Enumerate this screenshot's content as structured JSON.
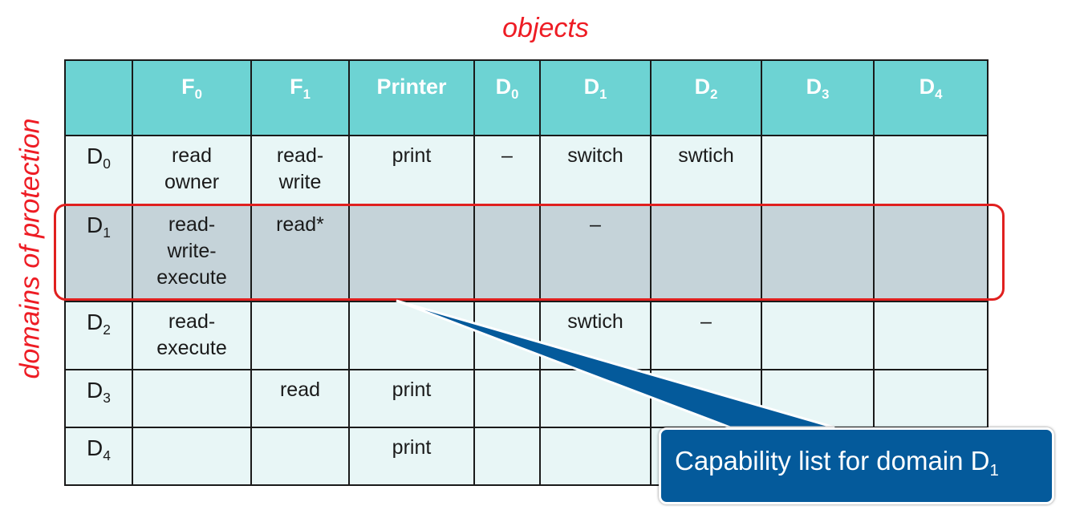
{
  "labels": {
    "objects": "objects",
    "domains": "domains of protection"
  },
  "columns": [
    {
      "base": "",
      "sub": ""
    },
    {
      "base": "F",
      "sub": "0"
    },
    {
      "base": "F",
      "sub": "1"
    },
    {
      "base": "Printer",
      "sub": ""
    },
    {
      "base": "D",
      "sub": "0"
    },
    {
      "base": "D",
      "sub": "1"
    },
    {
      "base": "D",
      "sub": "2"
    },
    {
      "base": "D",
      "sub": "3"
    },
    {
      "base": "D",
      "sub": "4"
    }
  ],
  "rows": [
    {
      "domain": {
        "base": "D",
        "sub": "0"
      },
      "cells": [
        "read\nowner",
        "read-\nwrite",
        "print",
        "–",
        "switch",
        "swtich",
        "",
        ""
      ]
    },
    {
      "domain": {
        "base": "D",
        "sub": "1"
      },
      "cells": [
        "read-\nwrite-\nexecute",
        "read*",
        "",
        "",
        "–",
        "",
        "",
        ""
      ]
    },
    {
      "domain": {
        "base": "D",
        "sub": "2"
      },
      "cells": [
        "read-\nexecute",
        "",
        "",
        "",
        "swtich",
        "–",
        "",
        ""
      ]
    },
    {
      "domain": {
        "base": "D",
        "sub": "3"
      },
      "cells": [
        "",
        "read",
        "print",
        "",
        "",
        "",
        "",
        ""
      ]
    },
    {
      "domain": {
        "base": "D",
        "sub": "4"
      },
      "cells": [
        "",
        "",
        "print",
        "",
        "",
        "",
        "",
        ""
      ]
    }
  ],
  "callout": {
    "text": "Capability list for domain D",
    "sub": "1"
  },
  "colors": {
    "header_bg": "#6dd3d3",
    "cell_bg": "#e8f6f6",
    "highlight_bg": "#c5d3d9",
    "highlight_border": "#e0201f",
    "label_red": "#ee1c24",
    "callout_bg": "#045a9b"
  }
}
